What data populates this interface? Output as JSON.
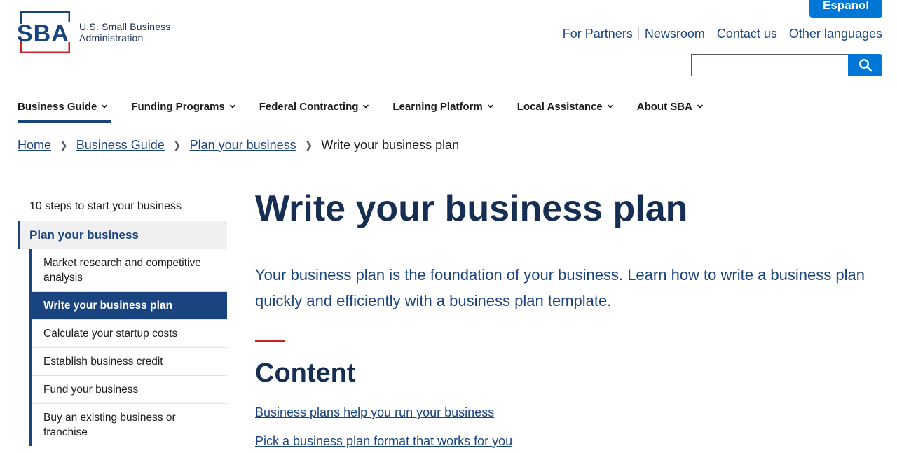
{
  "header": {
    "logo_line1": "U.S. Small Business",
    "logo_line2": "Administration",
    "espanol_label": "Espanol",
    "util_links": [
      "For Partners",
      "Newsroom",
      "Contact us",
      "Other languages"
    ],
    "search_placeholder": ""
  },
  "nav": {
    "items": [
      {
        "label": "Business Guide",
        "active": true
      },
      {
        "label": "Funding Programs"
      },
      {
        "label": "Federal Contracting"
      },
      {
        "label": "Learning Platform"
      },
      {
        "label": "Local Assistance"
      },
      {
        "label": "About SBA"
      }
    ]
  },
  "breadcrumb": {
    "items": [
      "Home",
      "Business Guide",
      "Plan your business"
    ],
    "current": "Write your business plan"
  },
  "sidenav": {
    "top": "10 steps to start your business",
    "parent": "Plan your business",
    "children": [
      "Market research and competitive analysis",
      "Write your business plan",
      "Calculate your startup costs",
      "Establish business credit",
      "Fund your business",
      "Buy an existing business or franchise"
    ],
    "selected_index": 1
  },
  "main": {
    "title": "Write your business plan",
    "intro": "Your business plan is the foundation of your business. Learn how to write a business plan quickly and efficiently with a business plan template.",
    "content_heading": "Content",
    "toc": [
      "Business plans help you run your business",
      "Pick a business plan format that works for you"
    ]
  },
  "colors": {
    "primary": "#1a4480",
    "dark_blue": "#162e51",
    "button_blue": "#0076d6",
    "accent_red": "#cd2026"
  }
}
